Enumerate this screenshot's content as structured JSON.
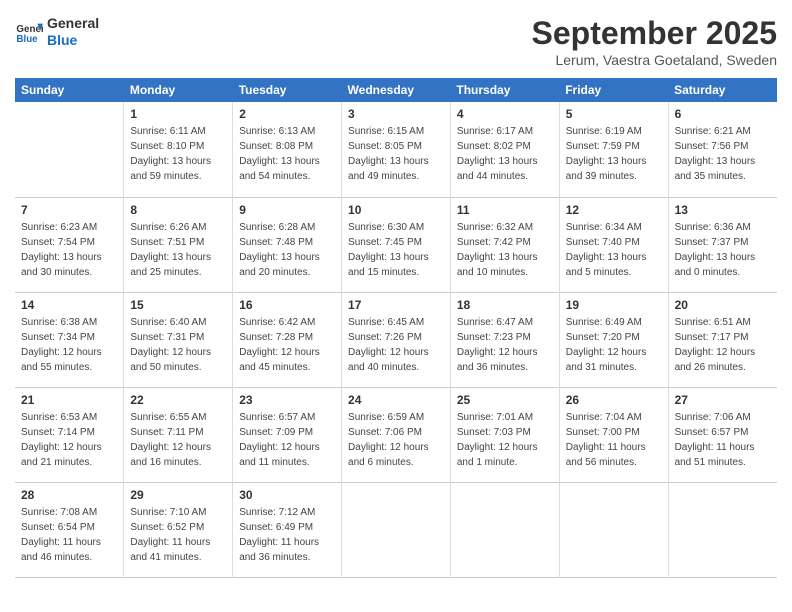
{
  "header": {
    "logo_line1": "General",
    "logo_line2": "Blue",
    "month": "September 2025",
    "location": "Lerum, Vaestra Goetaland, Sweden"
  },
  "days_of_week": [
    "Sunday",
    "Monday",
    "Tuesday",
    "Wednesday",
    "Thursday",
    "Friday",
    "Saturday"
  ],
  "weeks": [
    [
      {
        "day": "",
        "detail": ""
      },
      {
        "day": "1",
        "detail": "Sunrise: 6:11 AM\nSunset: 8:10 PM\nDaylight: 13 hours\nand 59 minutes."
      },
      {
        "day": "2",
        "detail": "Sunrise: 6:13 AM\nSunset: 8:08 PM\nDaylight: 13 hours\nand 54 minutes."
      },
      {
        "day": "3",
        "detail": "Sunrise: 6:15 AM\nSunset: 8:05 PM\nDaylight: 13 hours\nand 49 minutes."
      },
      {
        "day": "4",
        "detail": "Sunrise: 6:17 AM\nSunset: 8:02 PM\nDaylight: 13 hours\nand 44 minutes."
      },
      {
        "day": "5",
        "detail": "Sunrise: 6:19 AM\nSunset: 7:59 PM\nDaylight: 13 hours\nand 39 minutes."
      },
      {
        "day": "6",
        "detail": "Sunrise: 6:21 AM\nSunset: 7:56 PM\nDaylight: 13 hours\nand 35 minutes."
      }
    ],
    [
      {
        "day": "7",
        "detail": "Sunrise: 6:23 AM\nSunset: 7:54 PM\nDaylight: 13 hours\nand 30 minutes."
      },
      {
        "day": "8",
        "detail": "Sunrise: 6:26 AM\nSunset: 7:51 PM\nDaylight: 13 hours\nand 25 minutes."
      },
      {
        "day": "9",
        "detail": "Sunrise: 6:28 AM\nSunset: 7:48 PM\nDaylight: 13 hours\nand 20 minutes."
      },
      {
        "day": "10",
        "detail": "Sunrise: 6:30 AM\nSunset: 7:45 PM\nDaylight: 13 hours\nand 15 minutes."
      },
      {
        "day": "11",
        "detail": "Sunrise: 6:32 AM\nSunset: 7:42 PM\nDaylight: 13 hours\nand 10 minutes."
      },
      {
        "day": "12",
        "detail": "Sunrise: 6:34 AM\nSunset: 7:40 PM\nDaylight: 13 hours\nand 5 minutes."
      },
      {
        "day": "13",
        "detail": "Sunrise: 6:36 AM\nSunset: 7:37 PM\nDaylight: 13 hours\nand 0 minutes."
      }
    ],
    [
      {
        "day": "14",
        "detail": "Sunrise: 6:38 AM\nSunset: 7:34 PM\nDaylight: 12 hours\nand 55 minutes."
      },
      {
        "day": "15",
        "detail": "Sunrise: 6:40 AM\nSunset: 7:31 PM\nDaylight: 12 hours\nand 50 minutes."
      },
      {
        "day": "16",
        "detail": "Sunrise: 6:42 AM\nSunset: 7:28 PM\nDaylight: 12 hours\nand 45 minutes."
      },
      {
        "day": "17",
        "detail": "Sunrise: 6:45 AM\nSunset: 7:26 PM\nDaylight: 12 hours\nand 40 minutes."
      },
      {
        "day": "18",
        "detail": "Sunrise: 6:47 AM\nSunset: 7:23 PM\nDaylight: 12 hours\nand 36 minutes."
      },
      {
        "day": "19",
        "detail": "Sunrise: 6:49 AM\nSunset: 7:20 PM\nDaylight: 12 hours\nand 31 minutes."
      },
      {
        "day": "20",
        "detail": "Sunrise: 6:51 AM\nSunset: 7:17 PM\nDaylight: 12 hours\nand 26 minutes."
      }
    ],
    [
      {
        "day": "21",
        "detail": "Sunrise: 6:53 AM\nSunset: 7:14 PM\nDaylight: 12 hours\nand 21 minutes."
      },
      {
        "day": "22",
        "detail": "Sunrise: 6:55 AM\nSunset: 7:11 PM\nDaylight: 12 hours\nand 16 minutes."
      },
      {
        "day": "23",
        "detail": "Sunrise: 6:57 AM\nSunset: 7:09 PM\nDaylight: 12 hours\nand 11 minutes."
      },
      {
        "day": "24",
        "detail": "Sunrise: 6:59 AM\nSunset: 7:06 PM\nDaylight: 12 hours\nand 6 minutes."
      },
      {
        "day": "25",
        "detail": "Sunrise: 7:01 AM\nSunset: 7:03 PM\nDaylight: 12 hours\nand 1 minute."
      },
      {
        "day": "26",
        "detail": "Sunrise: 7:04 AM\nSunset: 7:00 PM\nDaylight: 11 hours\nand 56 minutes."
      },
      {
        "day": "27",
        "detail": "Sunrise: 7:06 AM\nSunset: 6:57 PM\nDaylight: 11 hours\nand 51 minutes."
      }
    ],
    [
      {
        "day": "28",
        "detail": "Sunrise: 7:08 AM\nSunset: 6:54 PM\nDaylight: 11 hours\nand 46 minutes."
      },
      {
        "day": "29",
        "detail": "Sunrise: 7:10 AM\nSunset: 6:52 PM\nDaylight: 11 hours\nand 41 minutes."
      },
      {
        "day": "30",
        "detail": "Sunrise: 7:12 AM\nSunset: 6:49 PM\nDaylight: 11 hours\nand 36 minutes."
      },
      {
        "day": "",
        "detail": ""
      },
      {
        "day": "",
        "detail": ""
      },
      {
        "day": "",
        "detail": ""
      },
      {
        "day": "",
        "detail": ""
      }
    ]
  ]
}
